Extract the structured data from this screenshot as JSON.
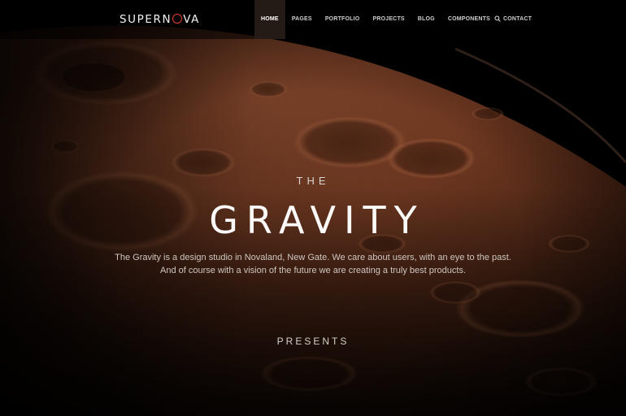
{
  "brand": {
    "logo_pre": "SUPERN",
    "logo_post": "VA",
    "accent": "#e0442c"
  },
  "nav": {
    "items": [
      {
        "label": "HOME",
        "active": true
      },
      {
        "label": "PAGES",
        "active": false
      },
      {
        "label": "PORTFOLIO",
        "active": false
      },
      {
        "label": "PROJECTS",
        "active": false
      },
      {
        "label": "BLOG",
        "active": false
      },
      {
        "label": "COMPONENTS",
        "active": false
      },
      {
        "label": "CONTACT",
        "active": false
      }
    ],
    "search_icon": "search-icon"
  },
  "hero": {
    "eyebrow": "THE",
    "title": "GRAVITY",
    "tagline_1": "The Gravity is a design studio in Novaland, New Gate. We care about users, with an eye to the past.",
    "tagline_2": "And of course with a vision of the future we are creating a truly best products.",
    "footer": "PRESENTS"
  },
  "colors": {
    "planet": "#8a4a2e",
    "space": "#000000"
  }
}
